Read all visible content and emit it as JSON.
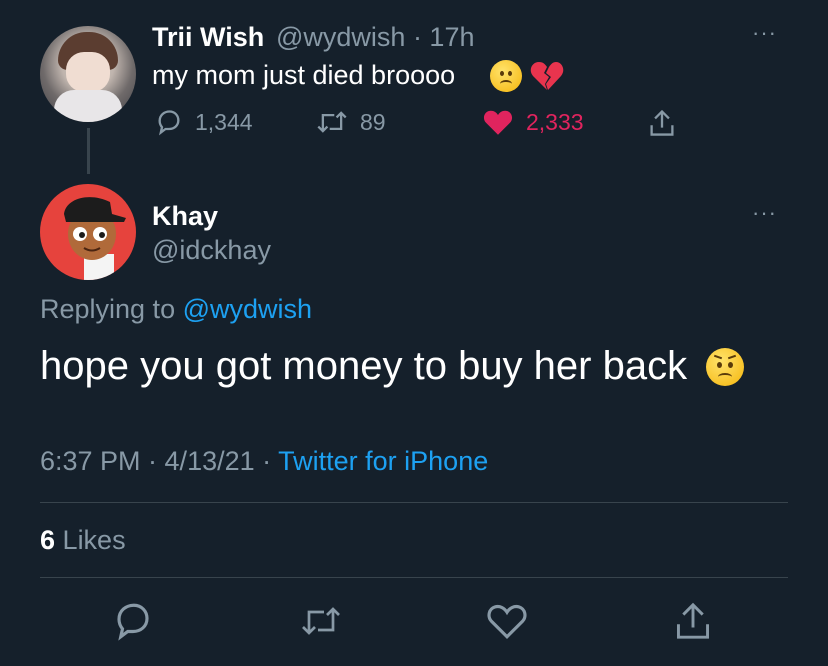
{
  "parent_tweet": {
    "name": "Trii Wish",
    "handle_time": "@wydwish · 17h",
    "text": "my mom just died broooo",
    "more": "···",
    "stats": {
      "replies": "1,344",
      "retweets": "89",
      "likes": "2,333"
    }
  },
  "reply_tweet": {
    "name": "Khay",
    "handle": "@idckhay",
    "more": "···",
    "replying_prefix": "Replying to",
    "replying_handle": "@wydwish",
    "text": "hope you got money to buy her back",
    "time_date": "6:37 PM · 4/13/21 ·",
    "source": "Twitter for iPhone",
    "likes_count": "6",
    "likes_label": "Likes"
  },
  "icons": {
    "reply": "reply-icon",
    "retweet": "retweet-icon",
    "like": "heart-icon",
    "share": "share-icon",
    "emoji_frown": "frowning-face-emoji",
    "emoji_broken_heart": "broken-heart-emoji",
    "emoji_worried": "worried-face-emoji"
  },
  "colors": {
    "background": "#15202b",
    "muted": "#8899a6",
    "link": "#1da1f2",
    "like": "#e0245e",
    "divider": "#38444d"
  }
}
